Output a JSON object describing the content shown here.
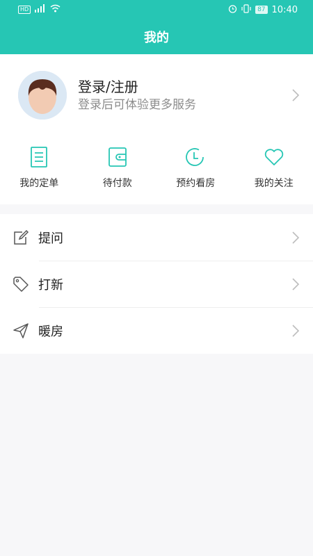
{
  "status_bar": {
    "left": "HD ⁴ᴳ",
    "battery": "87",
    "time": "10:40"
  },
  "header": {
    "title": "我的"
  },
  "profile": {
    "login_label": "登录/注册",
    "hint": "登录后可体验更多服务"
  },
  "quick_actions": [
    {
      "label": "我的定单",
      "icon": "document-icon"
    },
    {
      "label": "待付款",
      "icon": "wallet-icon"
    },
    {
      "label": "预约看房",
      "icon": "clock-icon"
    },
    {
      "label": "我的关注",
      "icon": "heart-icon"
    }
  ],
  "menu": [
    {
      "label": "提问",
      "icon": "edit-icon"
    },
    {
      "label": "打新",
      "icon": "tag-icon"
    },
    {
      "label": "暖房",
      "icon": "paper-plane-icon"
    }
  ],
  "colors": {
    "accent": "#26c6b4",
    "background": "#f7f7f9",
    "muted_text": "#8c8c8c"
  }
}
